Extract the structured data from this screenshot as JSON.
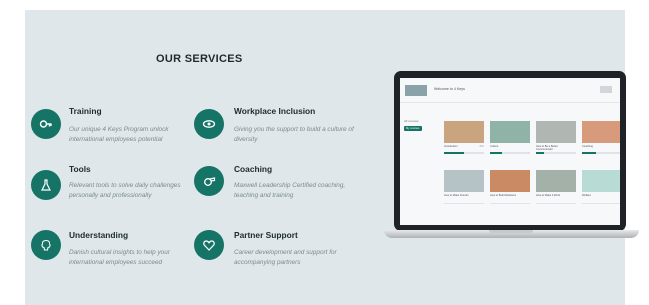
{
  "heading": "OUR SERVICES",
  "colors": {
    "accent": "#157466",
    "panel": "#dfe7ea",
    "text": "#1e2b2e",
    "muted": "#7b8a8f"
  },
  "services": [
    {
      "icon": "key-icon",
      "title": "Training",
      "desc": "Our unique 4 Keys Program unlock international employees potential"
    },
    {
      "icon": "eye-icon",
      "title": "Workplace Inclusion",
      "desc": "Giving you the support to build a culture of diversity"
    },
    {
      "icon": "flask-icon",
      "title": "Tools",
      "desc": "Relevant tools to solve daily challenges personally and professionally"
    },
    {
      "icon": "whistle-icon",
      "title": "Coaching",
      "desc": "Maxwell Leadership Certified coaching, teaching and training"
    },
    {
      "icon": "brain-icon",
      "title": "Understanding",
      "desc": "Danish cultural insights to help your international employees succeed"
    },
    {
      "icon": "heart-icon",
      "title": "Partner Support",
      "desc": "Career development and support for accompanying partners"
    }
  ],
  "laptop": {
    "app_title": "Welcome to 4 Keys",
    "side_label": "All courses",
    "side_button": "My courses",
    "cards": [
      {
        "text": "Introduction",
        "meta": "45%",
        "progress": 0.5,
        "color": "#c9a47e"
      },
      {
        "text": "Culture",
        "meta": "",
        "progress": 0.3,
        "color": "#8fb3a6"
      },
      {
        "text": "How to Be a Better Communicator",
        "meta": "",
        "progress": 0.2,
        "color": "#b0b7b3"
      },
      {
        "text": "Coaching",
        "meta": "",
        "progress": 0.35,
        "color": "#d79a7b"
      },
      {
        "text": "How to Make Friends",
        "meta": "",
        "progress": 0,
        "color": "#b5c2c6"
      },
      {
        "text": "How to Build Relations",
        "meta": "",
        "progress": 0,
        "color": "#c98a64"
      },
      {
        "text": "How to Make It Work",
        "meta": "",
        "progress": 0,
        "color": "#a3b1a9"
      },
      {
        "text": "Welfare",
        "meta": "",
        "progress": 0,
        "color": "#b8dbd5"
      }
    ]
  }
}
